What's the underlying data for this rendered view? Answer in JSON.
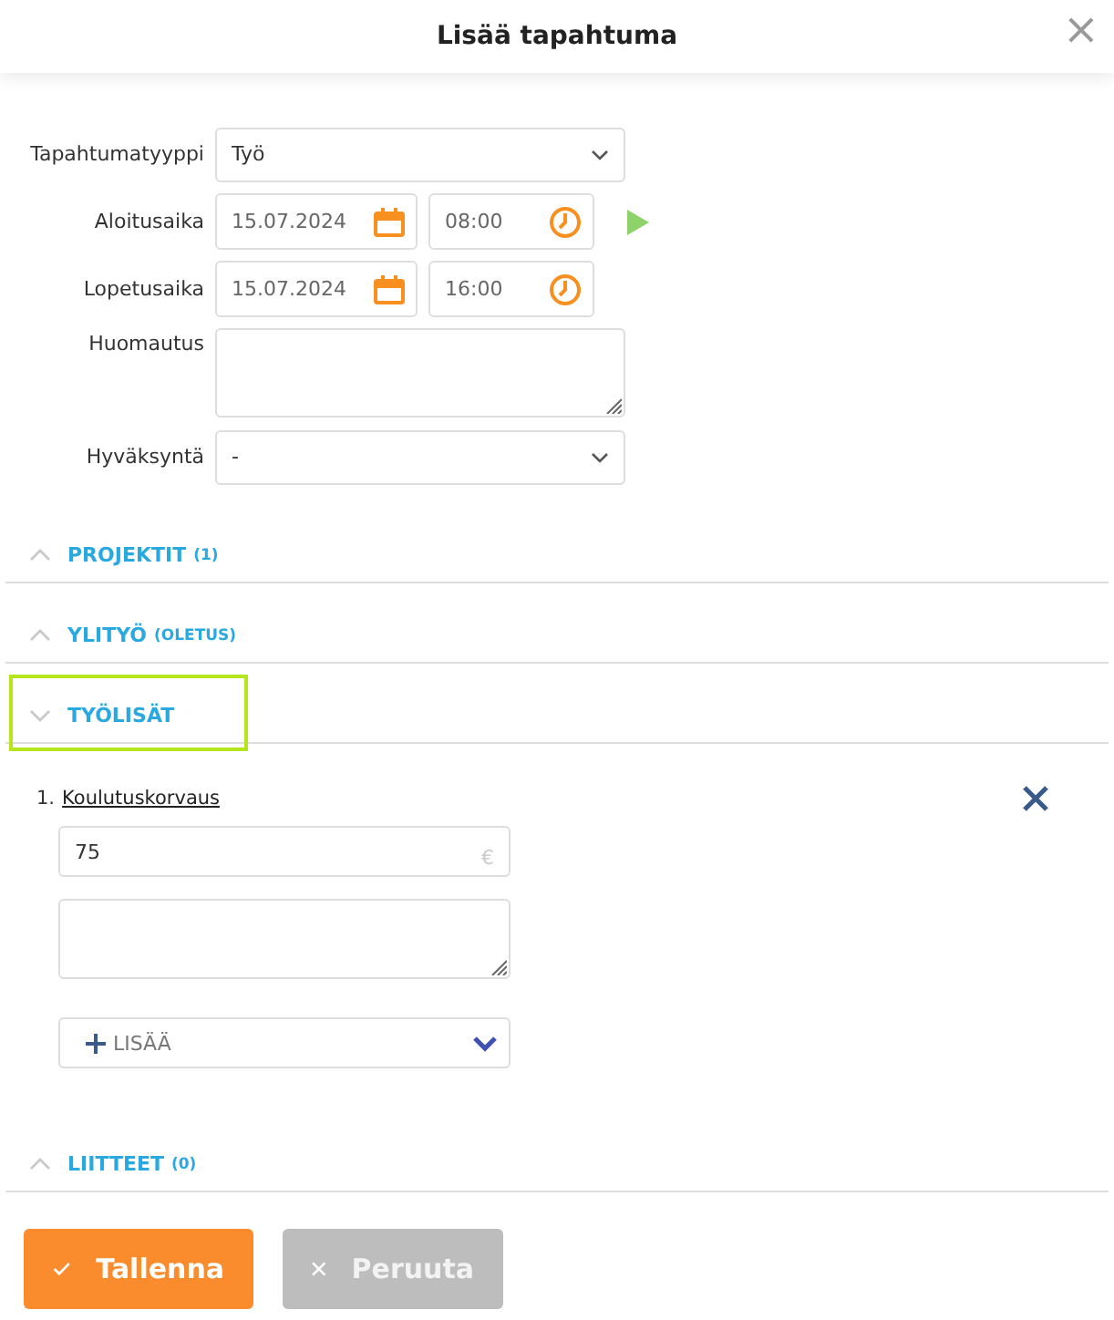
{
  "window": {
    "title": "Lisää tapahtuma",
    "close": "×"
  },
  "form": [
    {
      "kind": "select",
      "label": "Tapahtumatyyppi",
      "value": "Työ"
    },
    {
      "kind": "datetime",
      "label": "Aloitusaika",
      "date": "15.07.2024",
      "time": "08:00",
      "play": true
    },
    {
      "kind": "datetime",
      "label": "Lopetusaika",
      "date": "15.07.2024",
      "time": "16:00",
      "play": false
    },
    {
      "kind": "textarea",
      "label": "Huomautus"
    },
    {
      "kind": "select",
      "label": "Hyväksyntä",
      "value": "-"
    }
  ],
  "sections": [
    {
      "title": "PROJEKTIT",
      "note": "(1)",
      "expanded": false,
      "highlighted": false
    },
    {
      "title": "YLITYÖ",
      "note": "(OLETUS)",
      "expanded": false,
      "highlighted": false
    },
    {
      "title": "TYÖLISÄT",
      "expanded": true,
      "highlighted": true,
      "items": [
        {
          "number": "1.",
          "name": "Koulutuskorvaus",
          "amount": "75",
          "unit": "€"
        }
      ],
      "add": "LISÄÄ"
    },
    {
      "title": "LIITTEET",
      "note": "(0)",
      "expanded": false,
      "highlighted": false
    }
  ],
  "buttons": [
    {
      "kind": "primary",
      "label": "Tallenna"
    },
    {
      "kind": "secondary",
      "label": "Peruuta"
    }
  ]
}
